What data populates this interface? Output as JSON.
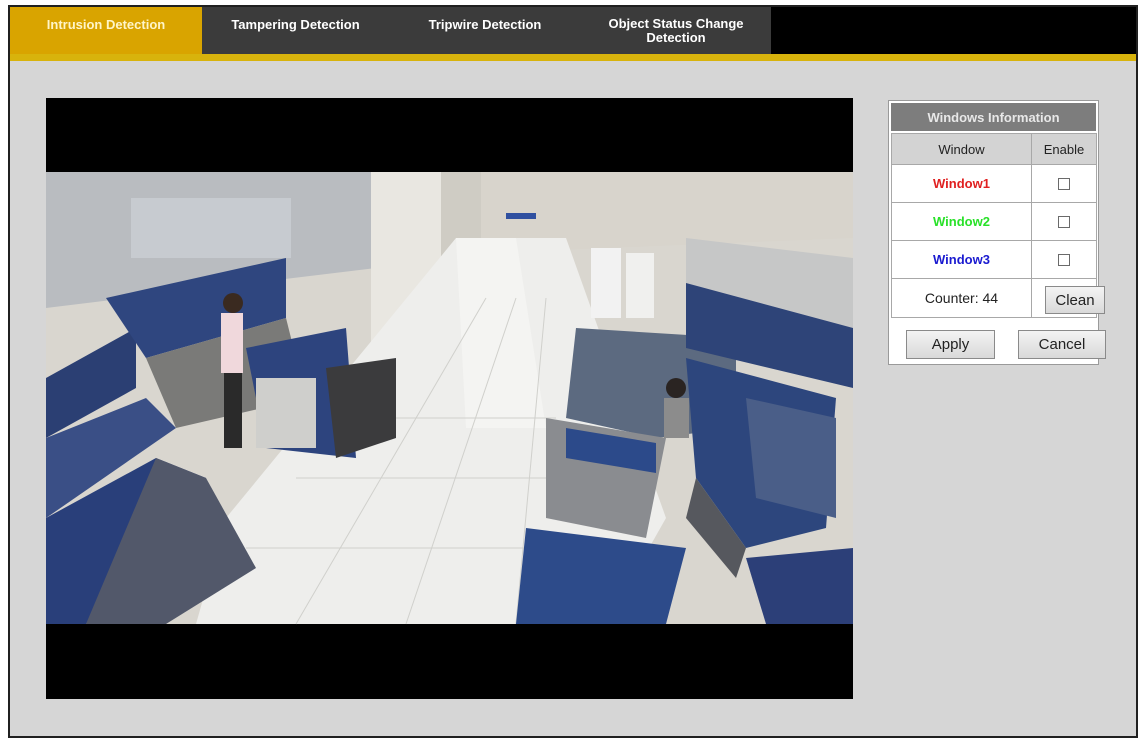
{
  "tabs": [
    {
      "label": "Intrusion Detection",
      "active": true
    },
    {
      "label": "Tampering Detection",
      "active": false
    },
    {
      "label": "Tripwire Detection",
      "active": false
    },
    {
      "label": "Object Status Change\nDetection",
      "active": false
    }
  ],
  "panel": {
    "title": "Windows Information",
    "col_window": "Window",
    "col_enable": "Enable",
    "windows": [
      {
        "label": "Window1",
        "color": "#e02020",
        "enabled": false
      },
      {
        "label": "Window2",
        "color": "#29e129",
        "enabled": false
      },
      {
        "label": "Window3",
        "color": "#1a1ad0",
        "enabled": false
      }
    ],
    "counter_label": "Counter: 44",
    "clean_label": "Clean",
    "apply_label": "Apply",
    "cancel_label": "Cancel"
  },
  "colors": {
    "active_tab": "#d9a400",
    "inactive_tab": "#3b3b3b",
    "accent_strip": "#d8b30c"
  }
}
